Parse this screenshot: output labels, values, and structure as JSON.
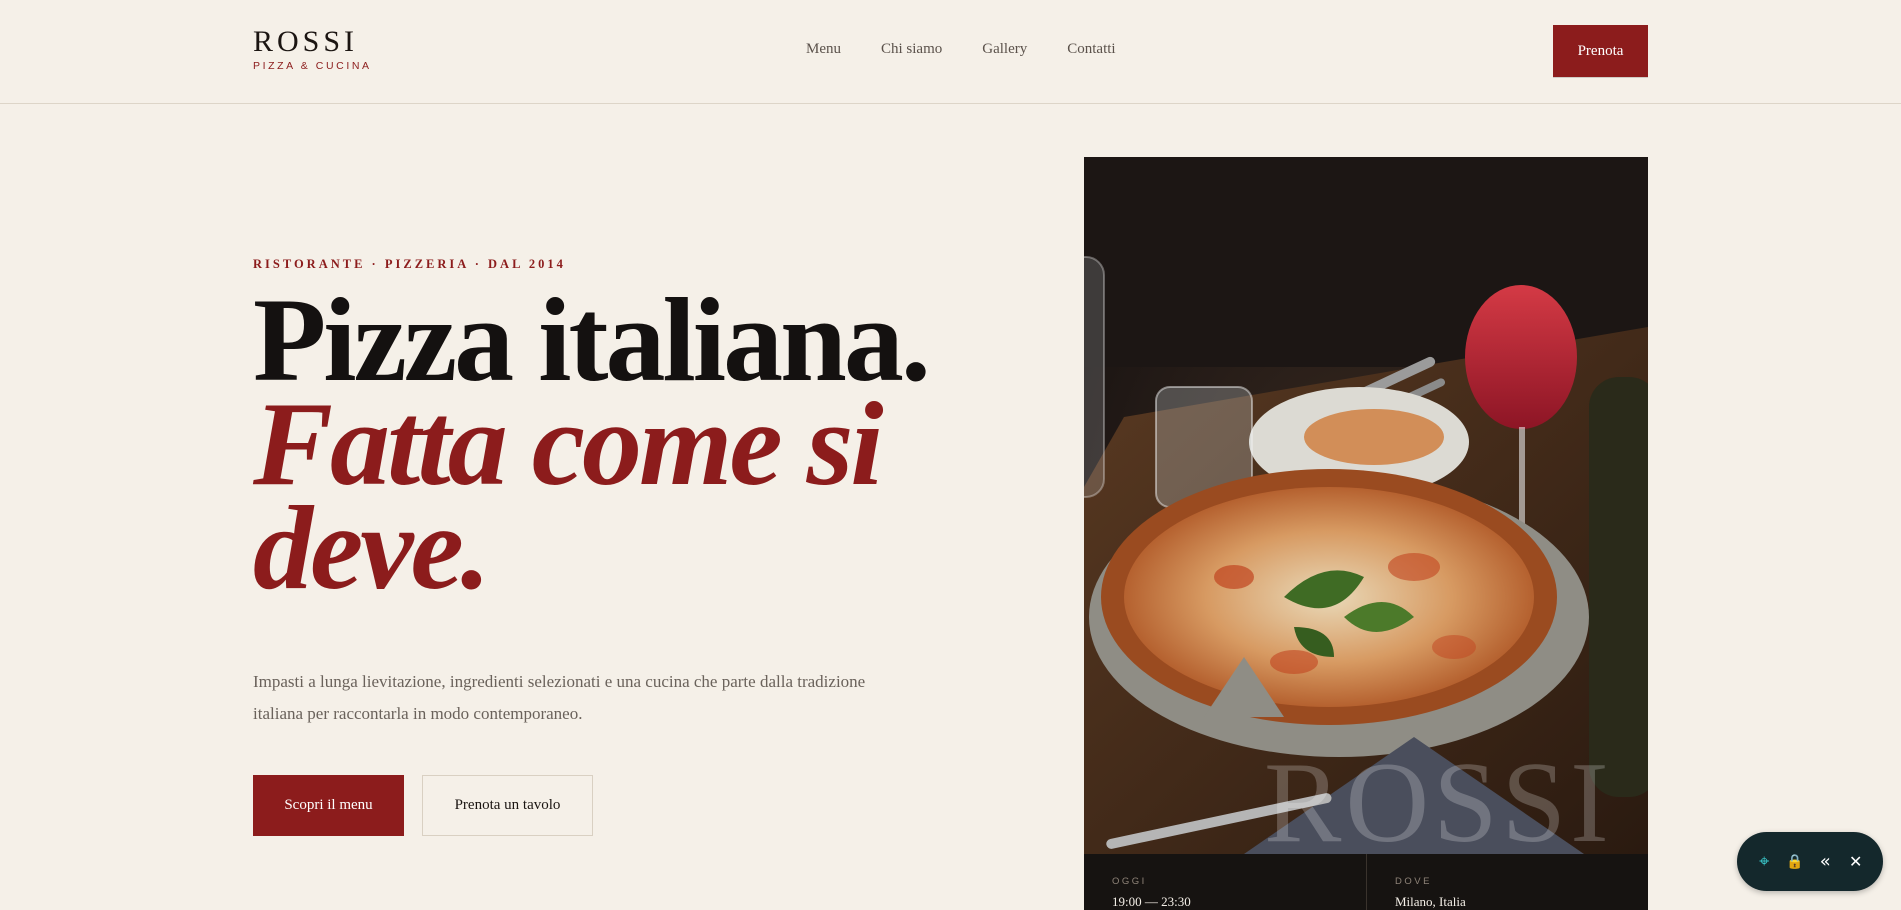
{
  "brand": {
    "name": "ROSSI",
    "tagline": "PIZZA & CUCINA"
  },
  "nav": {
    "items": [
      "Menu",
      "Chi siamo",
      "Gallery",
      "Contatti"
    ],
    "cta": "Prenota"
  },
  "hero": {
    "eyebrow": "RISTORANTE · PIZZERIA · DAL 2014",
    "title_line1": "Pizza italiana.",
    "title_line2": "Fatta come si deve.",
    "lead": "Impasti a lunga lievitazione, ingredienti selezionati e una cucina che parte dalla tradizione italiana per raccontarla in modo contemporaneo.",
    "primary_cta": "Scopri il menu",
    "secondary_cta": "Prenota un tavolo"
  },
  "image": {
    "watermark": "ROSSI"
  },
  "info": [
    {
      "label": "OGGI",
      "value": "19:00 — 23:30"
    },
    {
      "label": "DOVE",
      "value": "Milano, Italia"
    }
  ],
  "widget": {
    "icons": [
      "crosshair-icon",
      "lock-icon",
      "double-chevron-left-icon",
      "close-icon"
    ]
  },
  "colors": {
    "accent": "#8c1c1c",
    "background": "#f5f0e8",
    "dark": "#161311"
  }
}
